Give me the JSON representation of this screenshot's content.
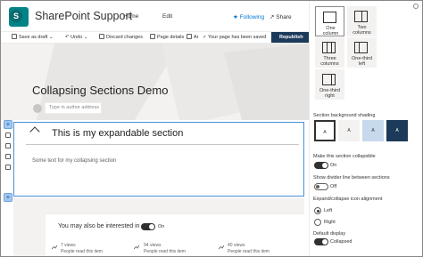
{
  "header": {
    "site_title": "SharePoint Support",
    "logo_letter": "S",
    "nav_home": "Home",
    "nav_edit": "Edit",
    "following": "★ Following",
    "share": "Share"
  },
  "command_bar": {
    "save_as_draft": "Save as draft",
    "undo": "Undo",
    "discard": "Discard changes",
    "page_details": "Page details",
    "ar": "Ar",
    "saved_status": "Your page has been saved",
    "republish": "Republish"
  },
  "page": {
    "title": "Collapsing Sections Demo",
    "author_placeholder": "Type in author address"
  },
  "section": {
    "plus_top": "+",
    "plus_bottom": "+",
    "title": "This is my expandable section",
    "body_text": "Some text for my collapsing section"
  },
  "related": {
    "title": "You may also be interested in",
    "toggle_label": "On",
    "items": [
      {
        "views": "7 views",
        "caption": "People read this item"
      },
      {
        "views": "94 views",
        "caption": "People read this item"
      },
      {
        "views": "40 views",
        "caption": "People read this item"
      }
    ]
  },
  "pane": {
    "layouts": [
      {
        "label1": "One",
        "label2": "column"
      },
      {
        "label1": "Two",
        "label2": "columns"
      },
      {
        "label1": "Three",
        "label2": "columns"
      },
      {
        "label1": "One-third",
        "label2": "left"
      },
      {
        "label1": "One-third",
        "label2": "right"
      }
    ],
    "shading_title": "Section background shading",
    "shading_sample": "A",
    "shading_colors": [
      "#ffffff",
      "#f3f2f1",
      "#c7d9ec",
      "#1c3a5a"
    ],
    "collapsible_title": "Make this section collapsible",
    "collapsible_state": "On",
    "divider_title": "Show divider line between sections",
    "divider_state": "Off",
    "alignment_title": "Expand/collapse icon alignment",
    "align_left": "Left",
    "align_right": "Right",
    "default_title": "Default display",
    "default_state": "Collapsed"
  }
}
